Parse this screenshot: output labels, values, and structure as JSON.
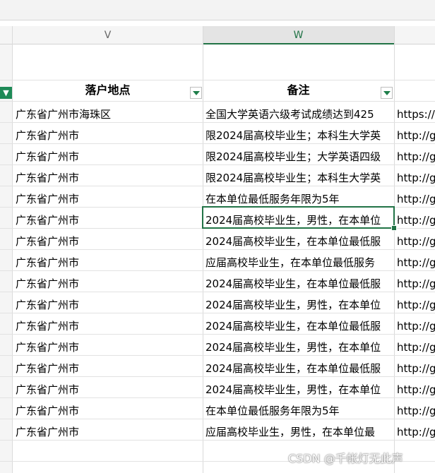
{
  "columns": {
    "v": "V",
    "w": "W"
  },
  "headers": {
    "location": "落户地点",
    "remarks": "备注"
  },
  "rows": [
    {
      "location": "广东省广州市海珠区",
      "remarks": "全国大学英语六级考试成绩达到425",
      "link": "https://v"
    },
    {
      "location": "广东省广州市",
      "remarks": "限2024届高校毕业生；本科生大学英",
      "link": "http://gu"
    },
    {
      "location": "广东省广州市",
      "remarks": "限2024届高校毕业生；大学英语四级",
      "link": "http://gu"
    },
    {
      "location": "广东省广州市",
      "remarks": "限2024届高校毕业生；本科生大学英",
      "link": "http://gu"
    },
    {
      "location": "广东省广州市",
      "remarks": "在本单位最低服务年限为5年",
      "link": "http://gu"
    },
    {
      "location": "广东省广州市",
      "remarks": "2024届高校毕业生，男性，在本单位",
      "link": "http://gu"
    },
    {
      "location": "广东省广州市",
      "remarks": "2024届高校毕业生，在本单位最低服",
      "link": "http://gu"
    },
    {
      "location": "广东省广州市",
      "remarks": "应届高校毕业生，在本单位最低服务",
      "link": "http://gu"
    },
    {
      "location": "广东省广州市",
      "remarks": "2024届高校毕业生，在本单位最低服",
      "link": "http://gu"
    },
    {
      "location": "广东省广州市",
      "remarks": "2024届高校毕业生，男性，在本单位",
      "link": "http://gu"
    },
    {
      "location": "广东省广州市",
      "remarks": "2024届高校毕业生，在本单位最低服",
      "link": "http://gu"
    },
    {
      "location": "广东省广州市",
      "remarks": "2024届高校毕业生，男性，在本单位",
      "link": "http://gu"
    },
    {
      "location": "广东省广州市",
      "remarks": "2024届高校毕业生，在本单位最低服",
      "link": "http://gu"
    },
    {
      "location": "广东省广州市",
      "remarks": "2024届高校毕业生，男性，在本单位",
      "link": "http://gu"
    },
    {
      "location": "广东省广州市",
      "remarks": "在本单位最低服务年限为5年",
      "link": "http://gu"
    },
    {
      "location": "广东省广州市",
      "remarks": "应届高校毕业生，男性，在本单位最",
      "link": "http://gu"
    }
  ],
  "watermark": "CSDN @千帐灯无此声",
  "filter_icon": "filter-active-icon"
}
